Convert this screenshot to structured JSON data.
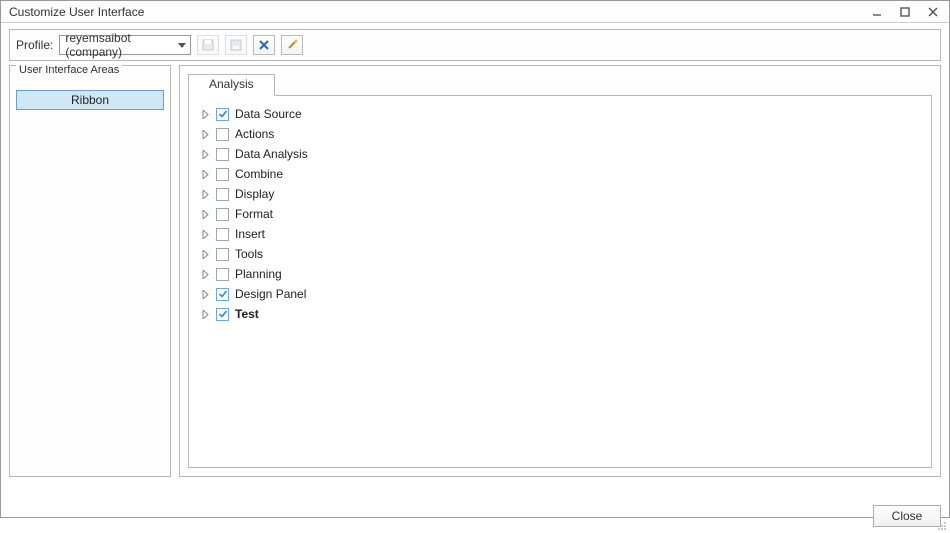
{
  "window": {
    "title": "Customize User Interface"
  },
  "profile": {
    "label": "Profile:",
    "value": "reyemsaibot  (company)"
  },
  "sidebar": {
    "legend": "User Interface Areas",
    "ribbon_label": "Ribbon"
  },
  "tabs": {
    "analysis_label": "Analysis"
  },
  "tree": {
    "items": [
      {
        "label": "Data Source",
        "checked": true,
        "bold": false
      },
      {
        "label": "Actions",
        "checked": false,
        "bold": false
      },
      {
        "label": "Data Analysis",
        "checked": false,
        "bold": false
      },
      {
        "label": "Combine",
        "checked": false,
        "bold": false
      },
      {
        "label": "Display",
        "checked": false,
        "bold": false
      },
      {
        "label": "Format",
        "checked": false,
        "bold": false
      },
      {
        "label": "Insert",
        "checked": false,
        "bold": false
      },
      {
        "label": "Tools",
        "checked": false,
        "bold": false
      },
      {
        "label": "Planning",
        "checked": false,
        "bold": false
      },
      {
        "label": "Design Panel",
        "checked": true,
        "bold": false
      },
      {
        "label": "Test",
        "checked": true,
        "bold": true
      }
    ]
  },
  "buttons": {
    "close": "Close"
  },
  "icons": {
    "toolbar1": "save-icon",
    "toolbar2": "save-as-icon",
    "toolbar3": "delete-x-icon",
    "toolbar4": "wand-icon"
  }
}
